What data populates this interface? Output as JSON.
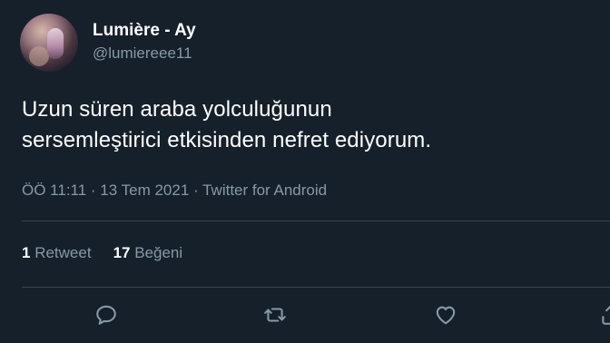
{
  "user": {
    "display_name": "Lumière - Ay",
    "handle": "@lumiereee11"
  },
  "tweet": {
    "text_line1": "Uzun süren araba yolculuğunun",
    "text_line2": "sersemleştirici etkisinden nefret ediyorum."
  },
  "meta": {
    "time": "ÖÖ 11:11",
    "separator": " · ",
    "date": "13 Tem 2021",
    "source": "Twitter for Android"
  },
  "stats": {
    "retweets_count": "1",
    "retweets_label": "Retweet",
    "likes_count": "17",
    "likes_label": "Beğeni"
  },
  "actions": {
    "reply_icon": "reply-icon",
    "retweet_icon": "retweet-icon",
    "like_icon": "heart-icon",
    "share_icon": "share-icon"
  },
  "colors": {
    "background": "#15202b",
    "primary_text": "#ffffff",
    "secondary_text": "#8899a6",
    "divider": "#38444d"
  }
}
